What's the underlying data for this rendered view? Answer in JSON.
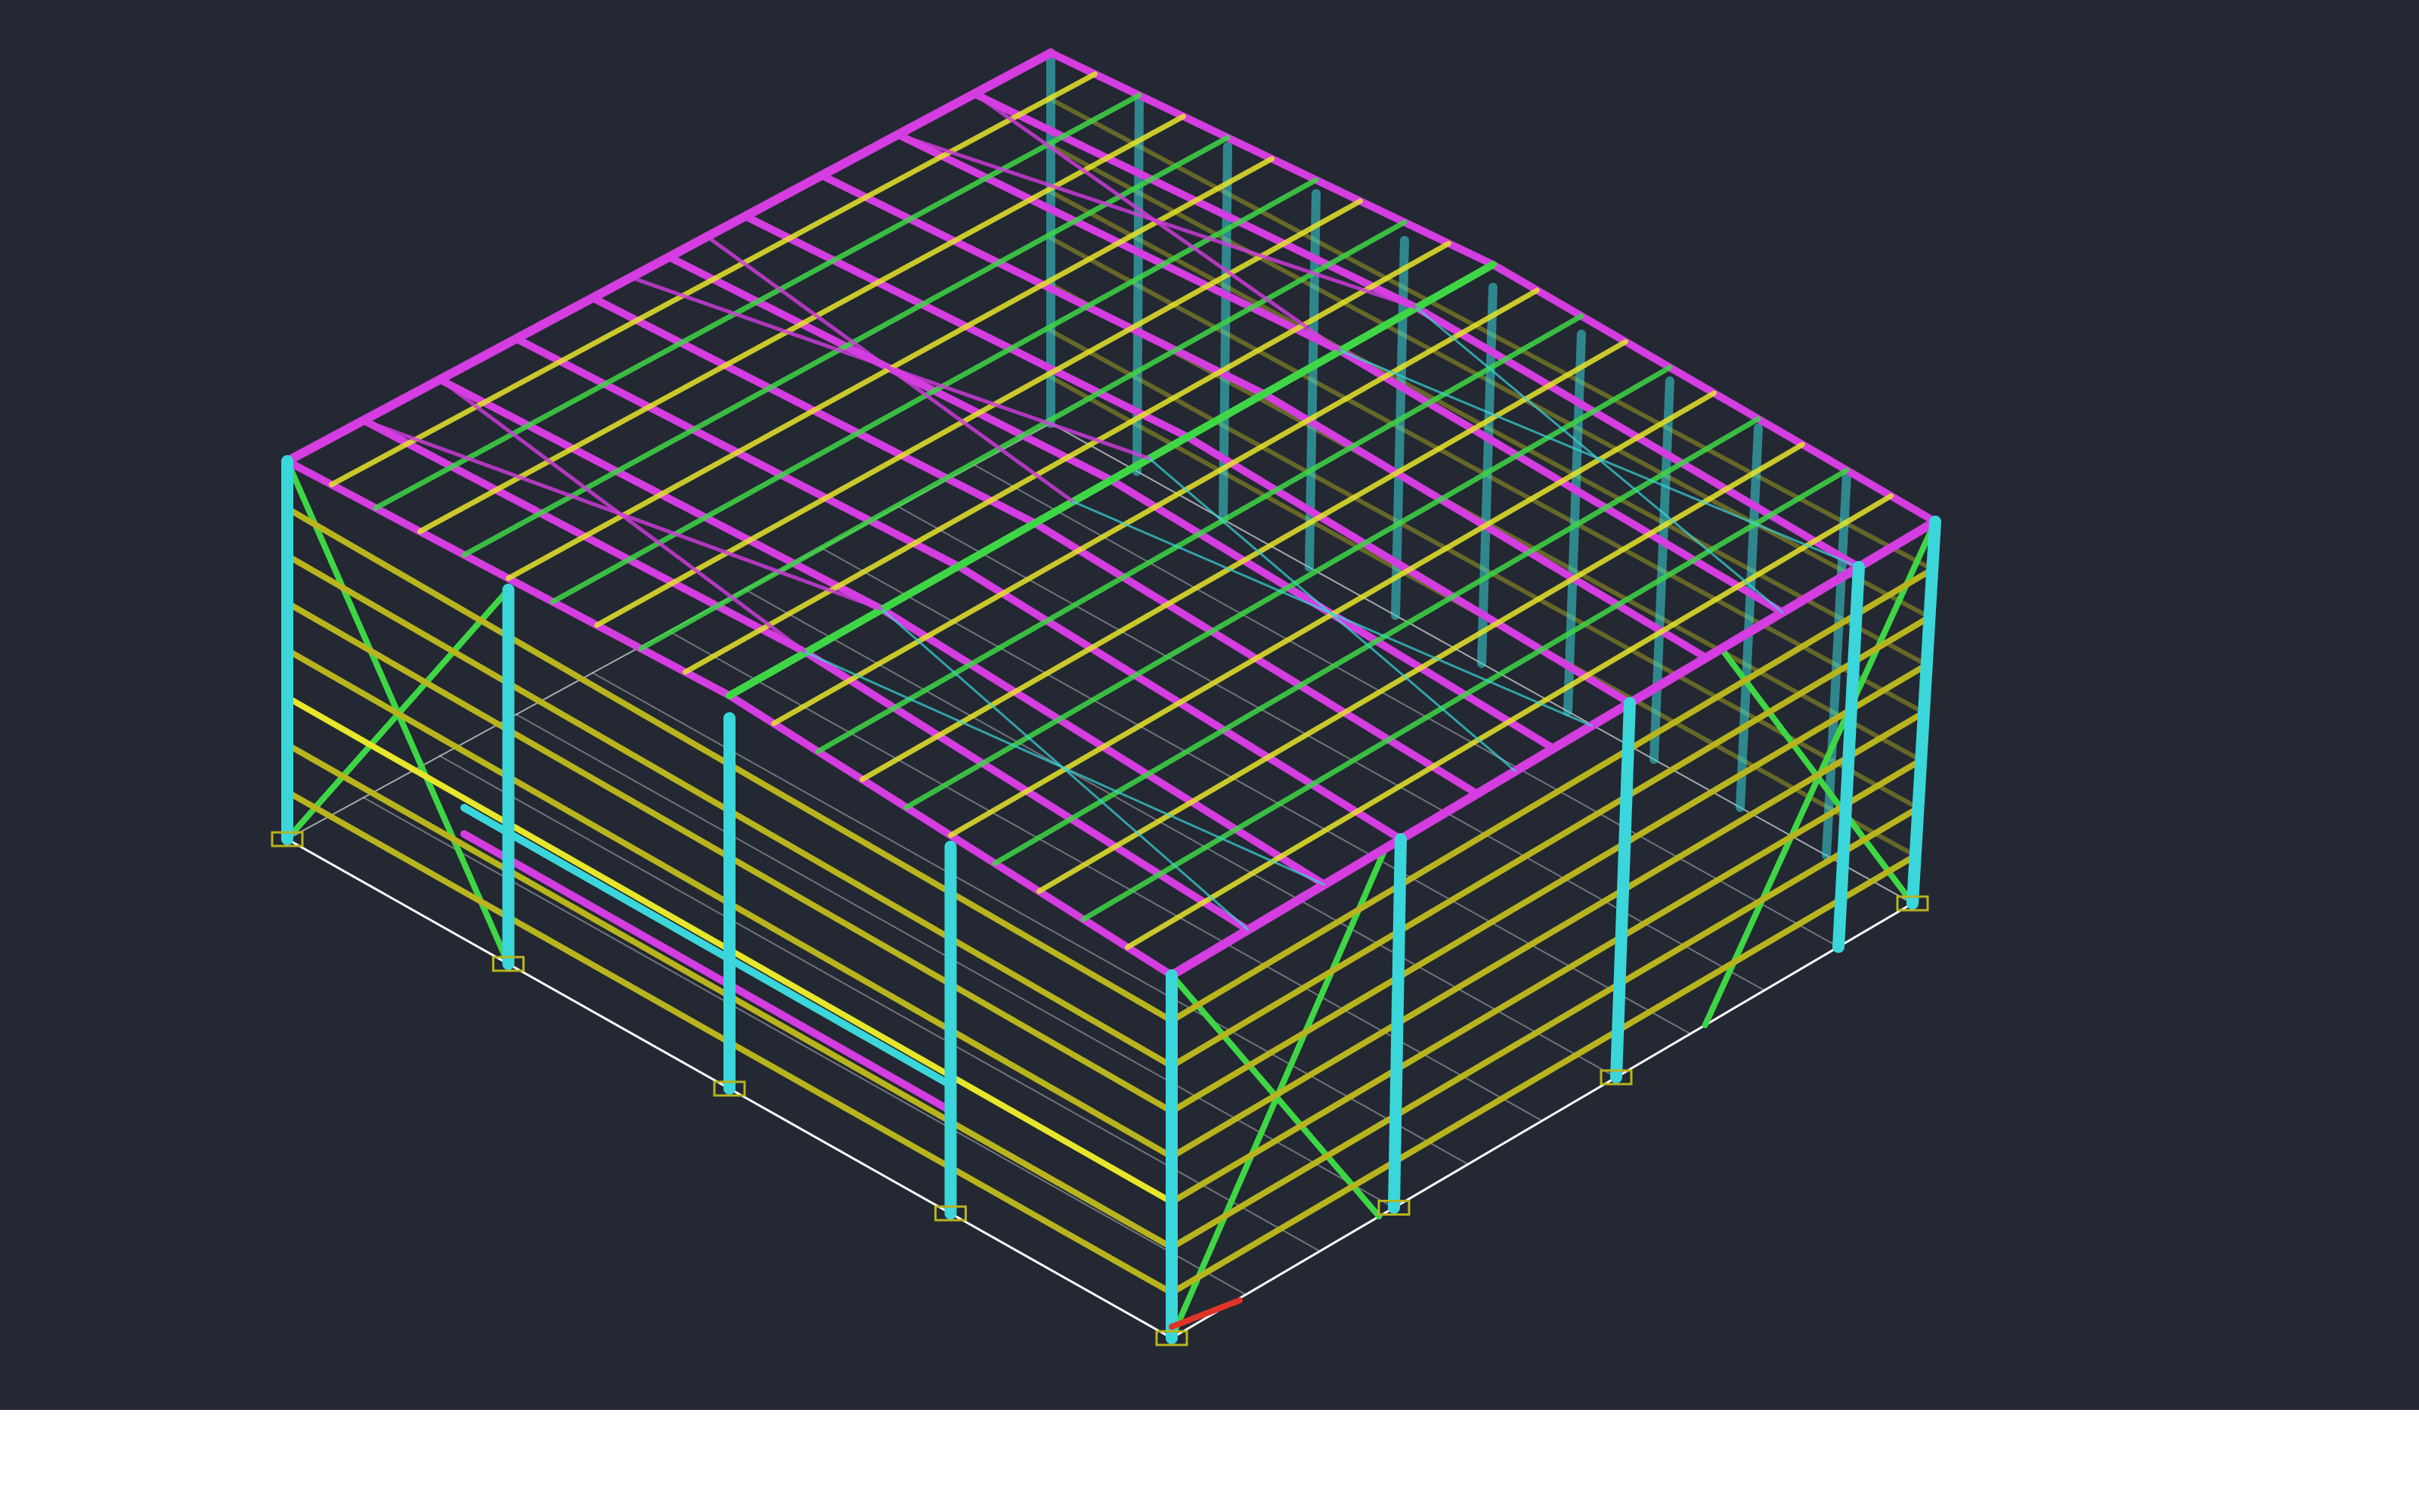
{
  "colors": {
    "background": "#232832",
    "column": "#3ad6d9",
    "rafter_purlin": "#d43de0",
    "girt": "#b8b41e",
    "eave_strut": "#e6e62a",
    "bracing": "#3fd646",
    "ground_line": "#ffffff",
    "accent_red": "#e0342a"
  },
  "scene": {
    "type": "isometric-steel-frame",
    "bays_long": 10,
    "bays_short": 4,
    "girt_levels": 7,
    "purlins_per_slope": 10
  }
}
